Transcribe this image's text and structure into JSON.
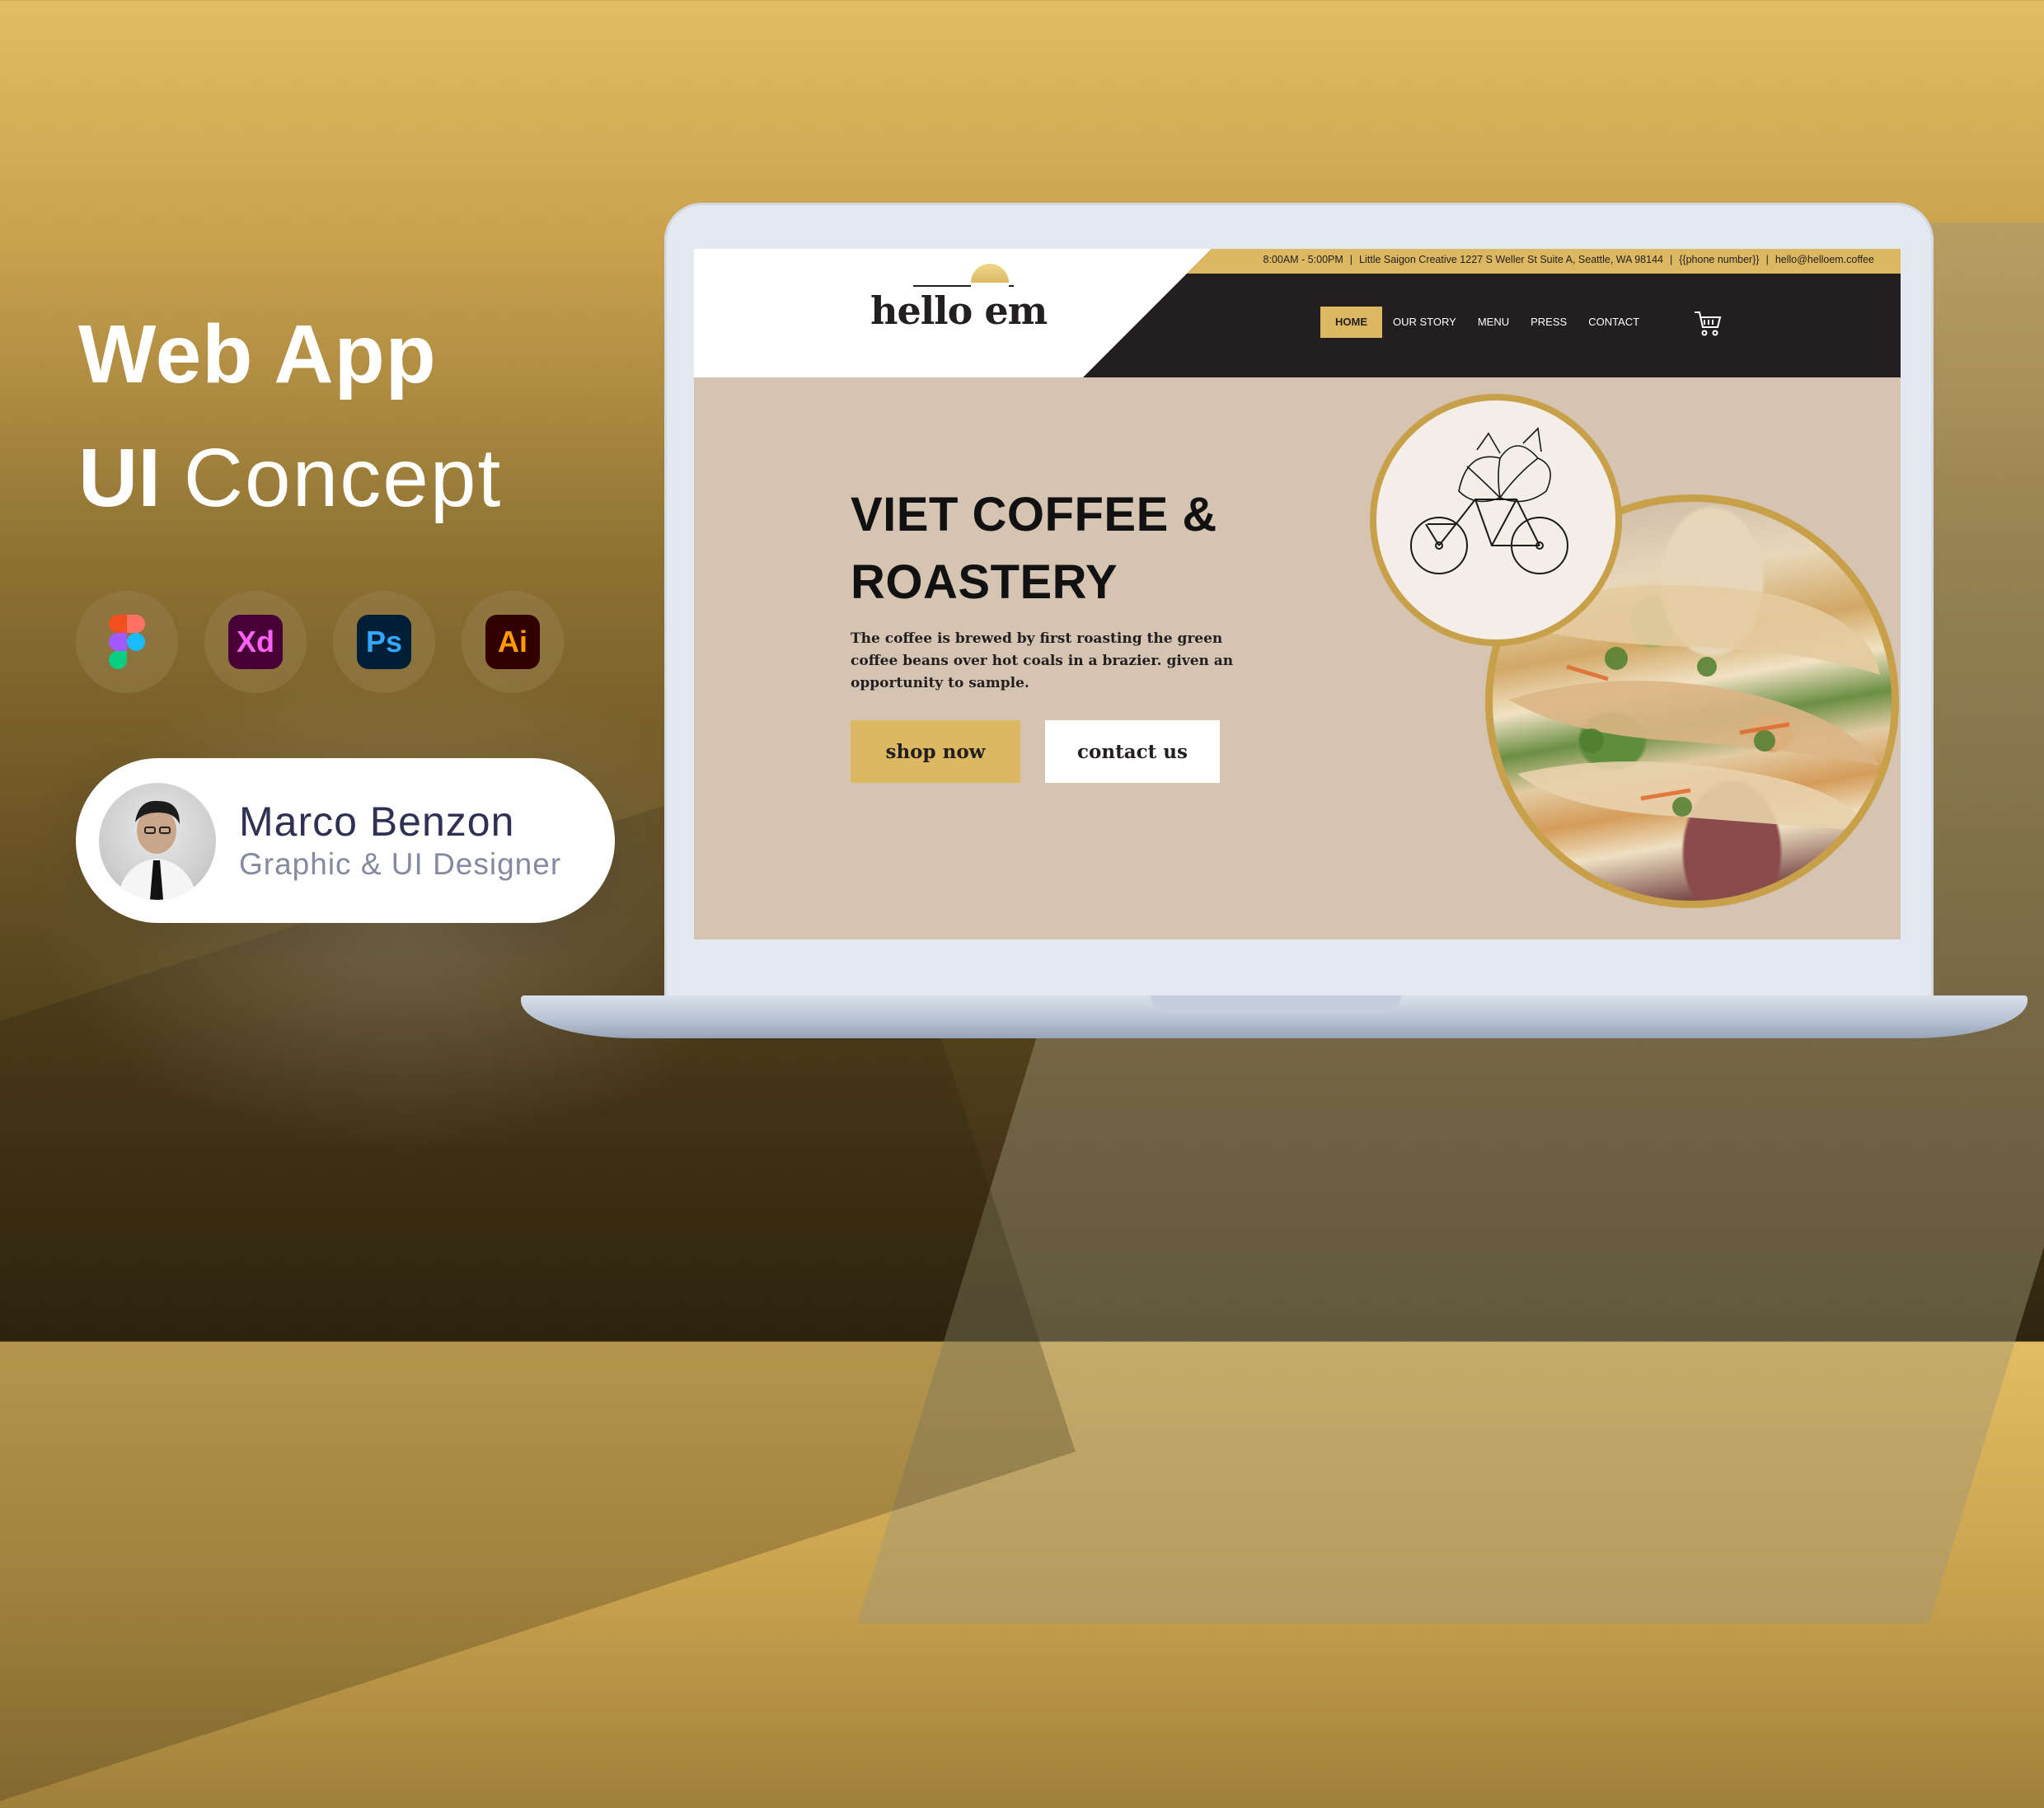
{
  "hero_left": {
    "title_line1": "Web App",
    "title_line2_bold": "UI",
    "title_line2_rest": "Concept"
  },
  "tools": [
    {
      "name": "Figma",
      "icon": "figma-icon"
    },
    {
      "name": "Xd",
      "icon": "adobe-xd-icon"
    },
    {
      "name": "Ps",
      "icon": "photoshop-icon"
    },
    {
      "name": "Ai",
      "icon": "illustrator-icon"
    }
  ],
  "profile": {
    "name": "Marco Benzon",
    "role": "Graphic & UI Designer"
  },
  "site": {
    "topbar": {
      "hours": "8:00AM - 5:00PM",
      "address": "Little Saigon Creative 1227 S Weller St Suite A, Seattle, WA 98144",
      "phone": "{{phone number}}",
      "email": "hello@helloem.coffee"
    },
    "logo": "hello em",
    "nav": [
      "HOME",
      "OUR STORY",
      "MENU",
      "PRESS",
      "CONTACT"
    ],
    "hero": {
      "title_line1": "VIET COFFEE &",
      "title_line2": "ROASTERY",
      "description": "The coffee is brewed by first roasting the green coffee beans over hot coals in a brazier. given an opportunity to sample.",
      "primary_button": "shop now",
      "secondary_button": "contact us"
    }
  },
  "colors": {
    "gold": "#dcb862",
    "dark": "#231f20",
    "hero_bg": "#d5c4b1"
  }
}
